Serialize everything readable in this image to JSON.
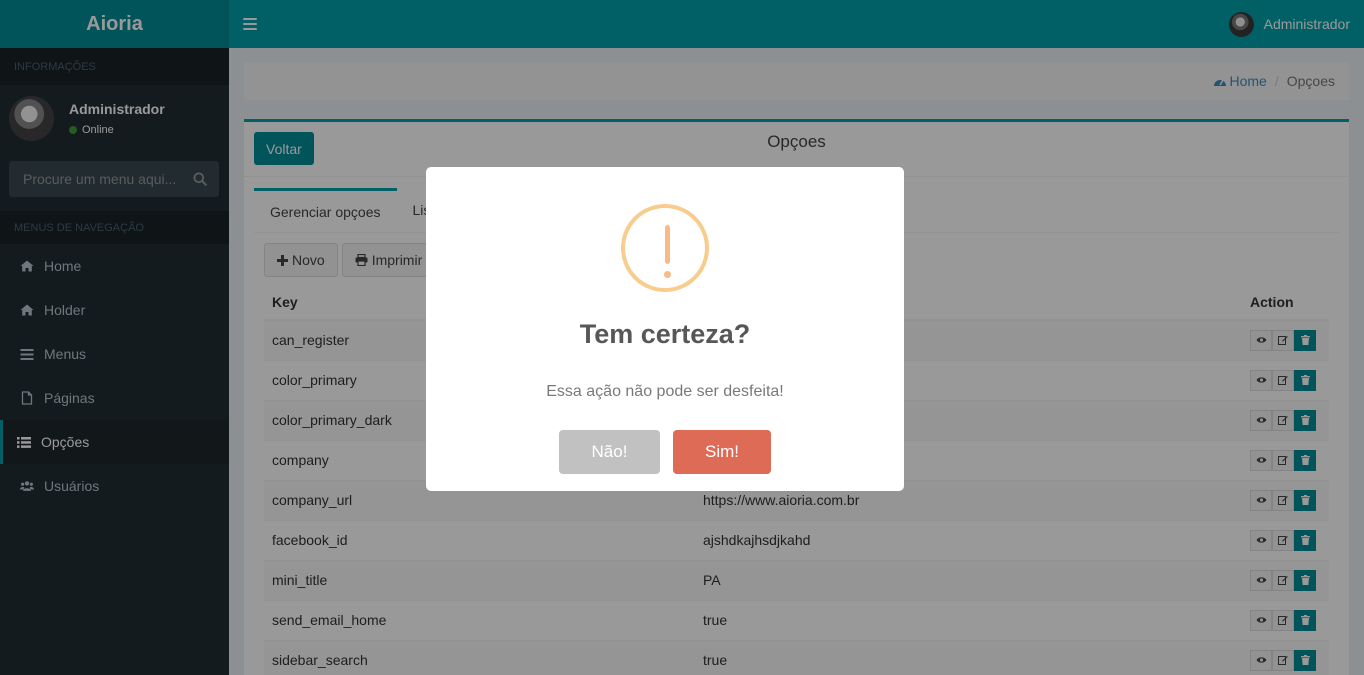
{
  "app": {
    "logo": "Aioria"
  },
  "header": {
    "user_name": "Administrador"
  },
  "sidebar": {
    "section_info": "INFORMAÇÕES",
    "user_name": "Administrador",
    "user_status": "Online",
    "search_placeholder": "Procure um menu aqui...",
    "section_nav": "MENUS DE NAVEGAÇÃO",
    "items": [
      {
        "label": "Home",
        "icon": "home-icon"
      },
      {
        "label": "Holder",
        "icon": "home-icon"
      },
      {
        "label": "Menus",
        "icon": "bars-icon"
      },
      {
        "label": "Páginas",
        "icon": "file-icon"
      },
      {
        "label": "Opções",
        "icon": "list-icon",
        "active": true
      },
      {
        "label": "Usuários",
        "icon": "users-icon"
      }
    ]
  },
  "breadcrumb": {
    "home": "Home",
    "current": "Opçoes"
  },
  "box": {
    "back_label": "Voltar",
    "title": "Opçoes",
    "tabs": [
      "Gerenciar opçoes",
      "Lis"
    ],
    "new_label": "Novo",
    "print_label": "Imprimir"
  },
  "table": {
    "headers": {
      "key": "Key",
      "action": "Action"
    },
    "rows": [
      {
        "key": "can_register",
        "value": ""
      },
      {
        "key": "color_primary",
        "value": ""
      },
      {
        "key": "color_primary_dark",
        "value": ""
      },
      {
        "key": "company",
        "value": ""
      },
      {
        "key": "company_url",
        "value": "https://www.aioria.com.br"
      },
      {
        "key": "facebook_id",
        "value": "ajshdkajhsdjkahd"
      },
      {
        "key": "mini_title",
        "value": "PA"
      },
      {
        "key": "send_email_home",
        "value": "true"
      },
      {
        "key": "sidebar_search",
        "value": "true"
      }
    ]
  },
  "modal": {
    "title": "Tem certeza?",
    "text": "Essa ação não pode ser desfeita!",
    "cancel_label": "Não!",
    "confirm_label": "Sim!",
    "icon": "warning-icon",
    "confirm_color": "#dd6b55"
  }
}
